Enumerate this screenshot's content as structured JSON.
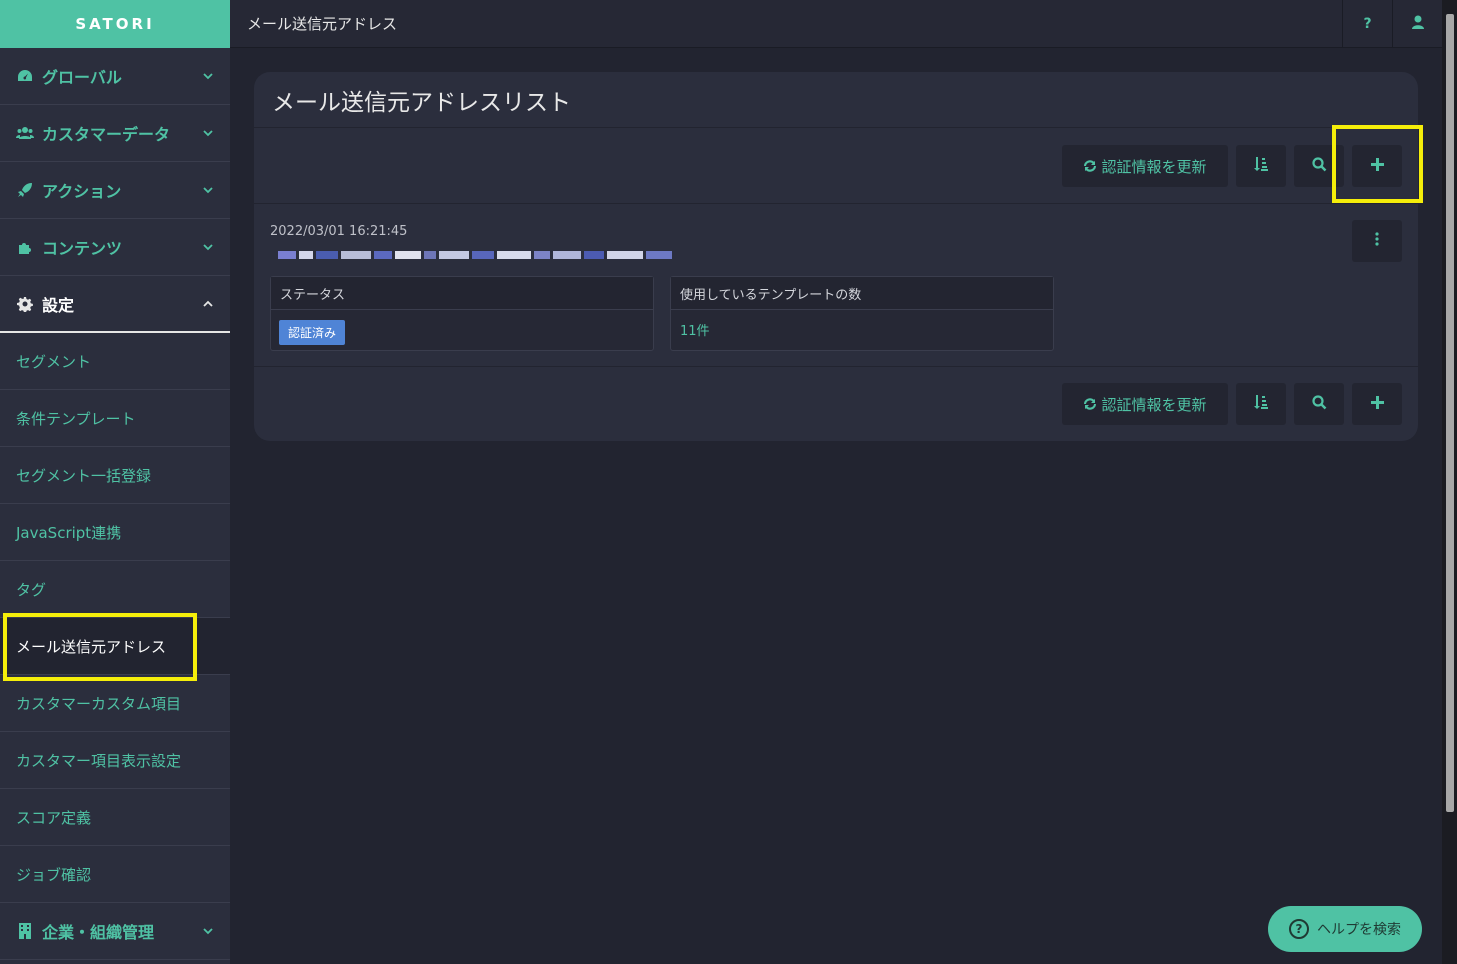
{
  "brand": "SATORI",
  "header": {
    "title": "メール送信元アドレス",
    "help_icon": "?",
    "user_icon": "user-icon"
  },
  "sidebar": {
    "groups": [
      {
        "label": "グローバル",
        "icon": "dashboard-icon"
      },
      {
        "label": "カスタマーデータ",
        "icon": "users-icon"
      },
      {
        "label": "アクション",
        "icon": "rocket-icon"
      },
      {
        "label": "コンテンツ",
        "icon": "puzzle-icon"
      },
      {
        "label": "設定",
        "icon": "gear-icon"
      }
    ],
    "items": [
      "セグメント",
      "条件テンプレート",
      "セグメント一括登録",
      "JavaScript連携",
      "タグ",
      "メール送信元アドレス",
      "カスタマーカスタム項目",
      "カスタマー項目表示設定",
      "スコア定義",
      "ジョブ確認"
    ],
    "footer_group": {
      "label": "企業・組織管理",
      "icon": "building-icon"
    }
  },
  "main": {
    "card_title": "メール送信元アドレスリスト",
    "toolbar": {
      "refresh_label": "認証情報を更新"
    },
    "entry": {
      "date": "2022/03/01 16:21:45",
      "status_header": "ステータス",
      "status_value": "認証済み",
      "template_header": "使用しているテンプレートの数",
      "template_count": "11件"
    }
  },
  "help_button": {
    "label": "ヘルプを検索"
  },
  "colors": {
    "accent": "#4fc2a4",
    "highlight": "#f5ee0a",
    "badge": "#4f84d6",
    "background": "#222430",
    "panel": "#2b2e3d"
  }
}
